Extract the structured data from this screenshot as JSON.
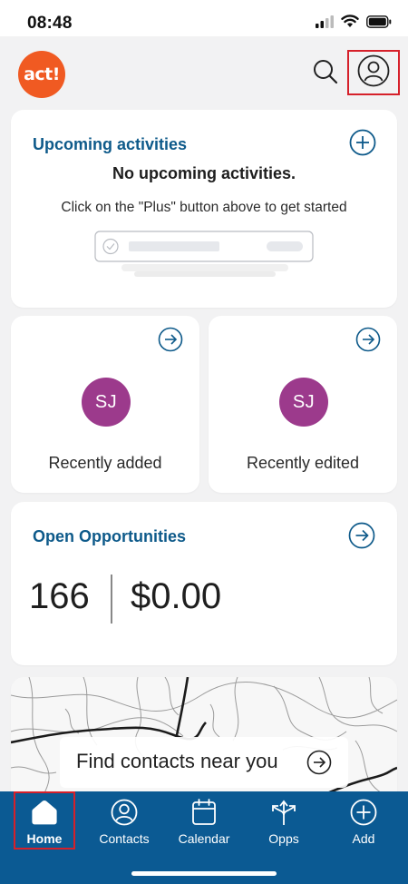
{
  "status_bar": {
    "time": "08:48"
  },
  "header": {
    "logo_text": "act!",
    "logo_color": "#f05a22"
  },
  "upcoming": {
    "title": "Upcoming activities",
    "empty_title": "No upcoming activities.",
    "empty_subtitle": "Click on the \"Plus\" button above to get started"
  },
  "recent": [
    {
      "initials": "SJ",
      "label": "Recently added"
    },
    {
      "initials": "SJ",
      "label": "Recently edited"
    }
  ],
  "opportunities": {
    "title": "Open Opportunities",
    "count": "166",
    "amount": "$0.00"
  },
  "map": {
    "find_label": "Find contacts near you"
  },
  "tabs": [
    {
      "label": "Home",
      "icon": "home-icon",
      "selected": true
    },
    {
      "label": "Contacts",
      "icon": "contacts-icon"
    },
    {
      "label": "Calendar",
      "icon": "calendar-icon"
    },
    {
      "label": "Opps",
      "icon": "opps-icon"
    },
    {
      "label": "Add",
      "icon": "add-icon"
    }
  ],
  "colors": {
    "accent_blue": "#0e5a8a",
    "tab_bar": "#0b5a93",
    "avatar": "#9c3a8c",
    "highlight_box": "#d6202a"
  }
}
